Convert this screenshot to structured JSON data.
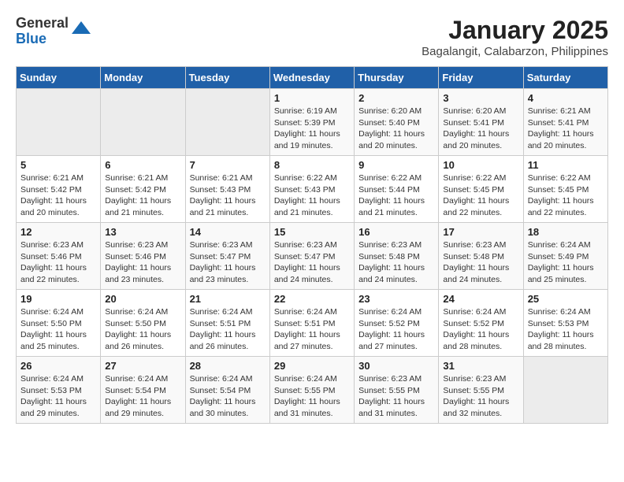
{
  "logo": {
    "general": "General",
    "blue": "Blue"
  },
  "title": "January 2025",
  "subtitle": "Bagalangit, Calabarzon, Philippines",
  "days_of_week": [
    "Sunday",
    "Monday",
    "Tuesday",
    "Wednesday",
    "Thursday",
    "Friday",
    "Saturday"
  ],
  "weeks": [
    [
      {
        "day": "",
        "info": ""
      },
      {
        "day": "",
        "info": ""
      },
      {
        "day": "",
        "info": ""
      },
      {
        "day": "1",
        "info": "Sunrise: 6:19 AM\nSunset: 5:39 PM\nDaylight: 11 hours and 19 minutes."
      },
      {
        "day": "2",
        "info": "Sunrise: 6:20 AM\nSunset: 5:40 PM\nDaylight: 11 hours and 20 minutes."
      },
      {
        "day": "3",
        "info": "Sunrise: 6:20 AM\nSunset: 5:41 PM\nDaylight: 11 hours and 20 minutes."
      },
      {
        "day": "4",
        "info": "Sunrise: 6:21 AM\nSunset: 5:41 PM\nDaylight: 11 hours and 20 minutes."
      }
    ],
    [
      {
        "day": "5",
        "info": "Sunrise: 6:21 AM\nSunset: 5:42 PM\nDaylight: 11 hours and 20 minutes."
      },
      {
        "day": "6",
        "info": "Sunrise: 6:21 AM\nSunset: 5:42 PM\nDaylight: 11 hours and 21 minutes."
      },
      {
        "day": "7",
        "info": "Sunrise: 6:21 AM\nSunset: 5:43 PM\nDaylight: 11 hours and 21 minutes."
      },
      {
        "day": "8",
        "info": "Sunrise: 6:22 AM\nSunset: 5:43 PM\nDaylight: 11 hours and 21 minutes."
      },
      {
        "day": "9",
        "info": "Sunrise: 6:22 AM\nSunset: 5:44 PM\nDaylight: 11 hours and 21 minutes."
      },
      {
        "day": "10",
        "info": "Sunrise: 6:22 AM\nSunset: 5:45 PM\nDaylight: 11 hours and 22 minutes."
      },
      {
        "day": "11",
        "info": "Sunrise: 6:22 AM\nSunset: 5:45 PM\nDaylight: 11 hours and 22 minutes."
      }
    ],
    [
      {
        "day": "12",
        "info": "Sunrise: 6:23 AM\nSunset: 5:46 PM\nDaylight: 11 hours and 22 minutes."
      },
      {
        "day": "13",
        "info": "Sunrise: 6:23 AM\nSunset: 5:46 PM\nDaylight: 11 hours and 23 minutes."
      },
      {
        "day": "14",
        "info": "Sunrise: 6:23 AM\nSunset: 5:47 PM\nDaylight: 11 hours and 23 minutes."
      },
      {
        "day": "15",
        "info": "Sunrise: 6:23 AM\nSunset: 5:47 PM\nDaylight: 11 hours and 24 minutes."
      },
      {
        "day": "16",
        "info": "Sunrise: 6:23 AM\nSunset: 5:48 PM\nDaylight: 11 hours and 24 minutes."
      },
      {
        "day": "17",
        "info": "Sunrise: 6:23 AM\nSunset: 5:48 PM\nDaylight: 11 hours and 24 minutes."
      },
      {
        "day": "18",
        "info": "Sunrise: 6:24 AM\nSunset: 5:49 PM\nDaylight: 11 hours and 25 minutes."
      }
    ],
    [
      {
        "day": "19",
        "info": "Sunrise: 6:24 AM\nSunset: 5:50 PM\nDaylight: 11 hours and 25 minutes."
      },
      {
        "day": "20",
        "info": "Sunrise: 6:24 AM\nSunset: 5:50 PM\nDaylight: 11 hours and 26 minutes."
      },
      {
        "day": "21",
        "info": "Sunrise: 6:24 AM\nSunset: 5:51 PM\nDaylight: 11 hours and 26 minutes."
      },
      {
        "day": "22",
        "info": "Sunrise: 6:24 AM\nSunset: 5:51 PM\nDaylight: 11 hours and 27 minutes."
      },
      {
        "day": "23",
        "info": "Sunrise: 6:24 AM\nSunset: 5:52 PM\nDaylight: 11 hours and 27 minutes."
      },
      {
        "day": "24",
        "info": "Sunrise: 6:24 AM\nSunset: 5:52 PM\nDaylight: 11 hours and 28 minutes."
      },
      {
        "day": "25",
        "info": "Sunrise: 6:24 AM\nSunset: 5:53 PM\nDaylight: 11 hours and 28 minutes."
      }
    ],
    [
      {
        "day": "26",
        "info": "Sunrise: 6:24 AM\nSunset: 5:53 PM\nDaylight: 11 hours and 29 minutes."
      },
      {
        "day": "27",
        "info": "Sunrise: 6:24 AM\nSunset: 5:54 PM\nDaylight: 11 hours and 29 minutes."
      },
      {
        "day": "28",
        "info": "Sunrise: 6:24 AM\nSunset: 5:54 PM\nDaylight: 11 hours and 30 minutes."
      },
      {
        "day": "29",
        "info": "Sunrise: 6:24 AM\nSunset: 5:55 PM\nDaylight: 11 hours and 31 minutes."
      },
      {
        "day": "30",
        "info": "Sunrise: 6:23 AM\nSunset: 5:55 PM\nDaylight: 11 hours and 31 minutes."
      },
      {
        "day": "31",
        "info": "Sunrise: 6:23 AM\nSunset: 5:55 PM\nDaylight: 11 hours and 32 minutes."
      },
      {
        "day": "",
        "info": ""
      }
    ]
  ]
}
